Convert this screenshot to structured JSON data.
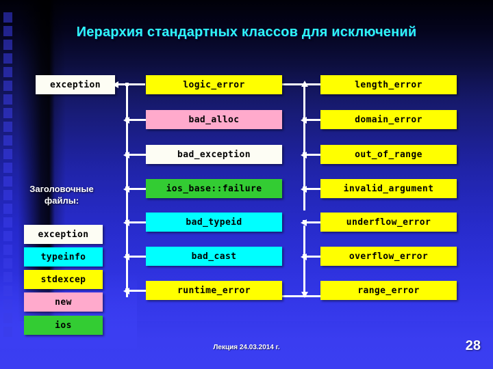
{
  "slide": {
    "title": "Иерархия стандартных классов для исключений",
    "title_color": "#2FF6F6",
    "footer_note": "Лекция 24.03.2014 г.",
    "page_number": "28"
  },
  "root": {
    "label": "exception",
    "color": "#FDFDF4"
  },
  "legend": {
    "heading_line1": "Заголовочные",
    "heading_line2": "файлы:",
    "items": [
      {
        "label": "exception",
        "color": "#FDFDF4",
        "swatch": "white"
      },
      {
        "label": "typeinfo",
        "color": "#00FFFF",
        "swatch": "cyan"
      },
      {
        "label": "stdexcep",
        "color": "#FFFF00",
        "swatch": "yellow"
      },
      {
        "label": "new",
        "color": "#FFAACC",
        "swatch": "pink"
      },
      {
        "label": "ios",
        "color": "#33CC33",
        "swatch": "green"
      }
    ]
  },
  "middle_column": [
    {
      "label": "logic_error",
      "color": "#FFFF00",
      "swatch": "yellow"
    },
    {
      "label": "bad_alloc",
      "color": "#FFAACC",
      "swatch": "pink"
    },
    {
      "label": "bad_exception",
      "color": "#FDFDF4",
      "swatch": "white"
    },
    {
      "label": "ios_base::failure",
      "color": "#33CC33",
      "swatch": "green"
    },
    {
      "label": "bad_typeid",
      "color": "#00FFFF",
      "swatch": "cyan"
    },
    {
      "label": "bad_cast",
      "color": "#00FFFF",
      "swatch": "cyan"
    },
    {
      "label": "runtime_error",
      "color": "#FFFF00",
      "swatch": "yellow"
    }
  ],
  "right_column": [
    {
      "label": "length_error",
      "color": "#FFFF00",
      "swatch": "yellow"
    },
    {
      "label": "domain_error",
      "color": "#FFFF00",
      "swatch": "yellow"
    },
    {
      "label": "out_of_range",
      "color": "#FFFF00",
      "swatch": "yellow"
    },
    {
      "label": "invalid_argument",
      "color": "#FFFF00",
      "swatch": "yellow"
    },
    {
      "label": "underflow_error",
      "color": "#FFFF00",
      "swatch": "yellow"
    },
    {
      "label": "overflow_error",
      "color": "#FFFF00",
      "swatch": "yellow"
    },
    {
      "label": "range_error",
      "color": "#FFFF00",
      "swatch": "yellow"
    }
  ]
}
